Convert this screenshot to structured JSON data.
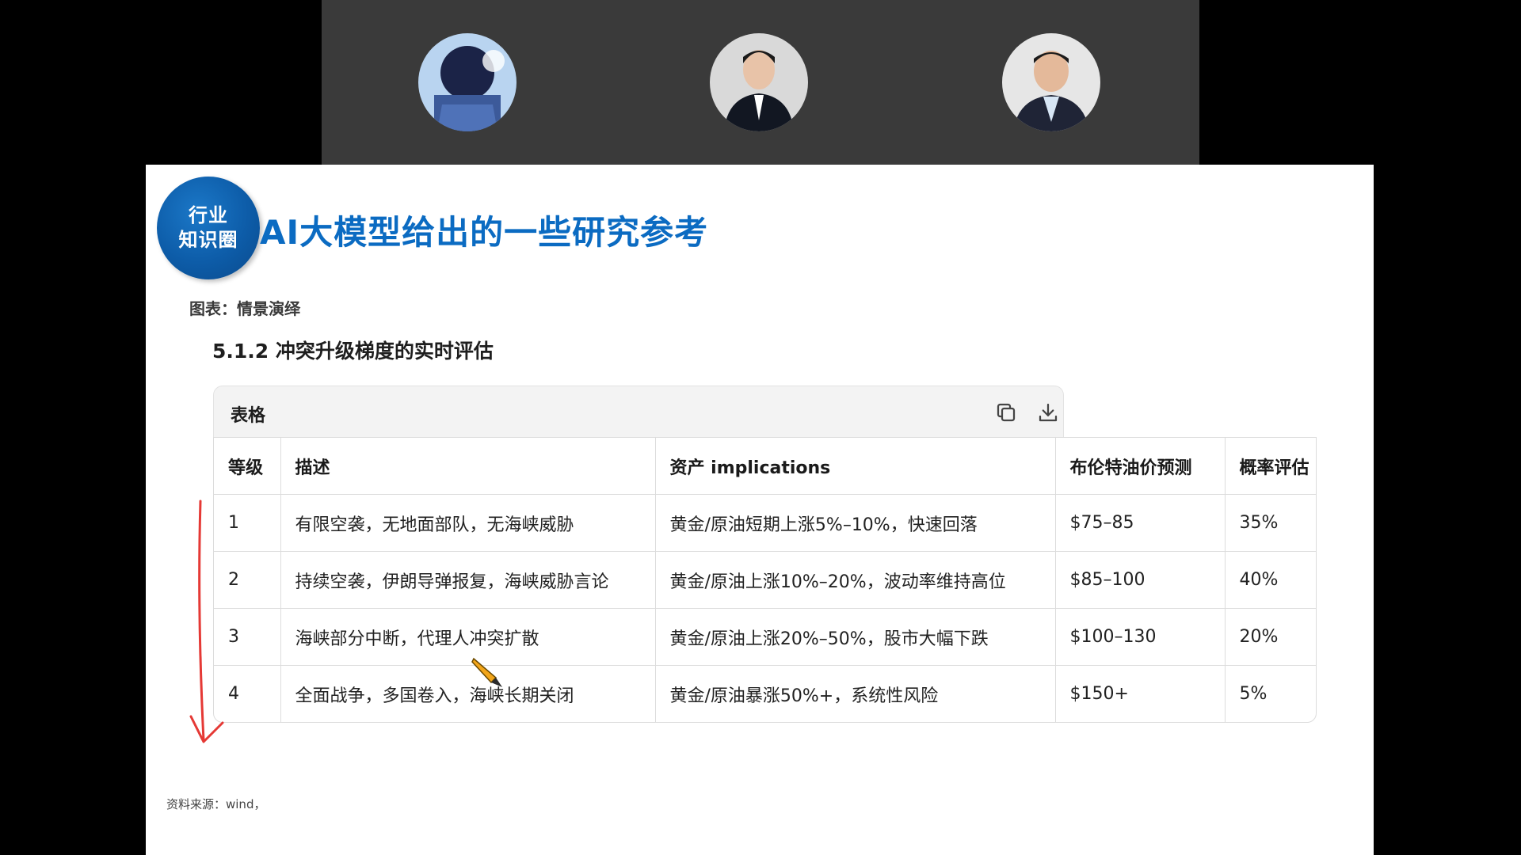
{
  "participants": [
    {
      "name": "participant-1",
      "avatar_colors": [
        "#1e2a55",
        "#a8c6ea"
      ]
    },
    {
      "name": "participant-2",
      "avatar_colors": [
        "#1a1a1a",
        "#d8d8d8"
      ]
    },
    {
      "name": "participant-3",
      "avatar_colors": [
        "#1f2436",
        "#cfcfcf"
      ]
    }
  ],
  "slide": {
    "logo_line1": "行业",
    "logo_line2": "知识圈",
    "title": "AI大模型给出的一些研究参考",
    "chart_label": "图表：情景演绎",
    "section_title": "5.1.2 冲突升级梯度的实时评估",
    "source": "资料来源：wind，"
  },
  "table_card": {
    "title": "表格",
    "copy_icon": "copy-icon",
    "download_icon": "download-icon"
  },
  "table": {
    "headers": [
      "等级",
      "描述",
      "资产 implications",
      "布伦特油价预测",
      "概率评估"
    ],
    "rows": [
      [
        "1",
        "有限空袭，无地面部队，无海峡威胁",
        "黄金/原油短期上涨5%–10%，快速回落",
        "$75–85",
        "35%"
      ],
      [
        "2",
        "持续空袭，伊朗导弹报复，海峡威胁言论",
        "黄金/原油上涨10%–20%，波动率维持高位",
        "$85–100",
        "40%"
      ],
      [
        "3",
        "海峡部分中断，代理人冲突扩散",
        "黄金/原油上涨20%–50%，股市大幅下跌",
        "$100–130",
        "20%"
      ],
      [
        "4",
        "全面战争，多国卷入，海峡长期关闭",
        "黄金/原油暴涨50%+，系统性风险",
        "$150+",
        "5%"
      ]
    ]
  },
  "colors": {
    "brand_blue": "#0b6bc2",
    "annotation_red": "#e53935"
  }
}
